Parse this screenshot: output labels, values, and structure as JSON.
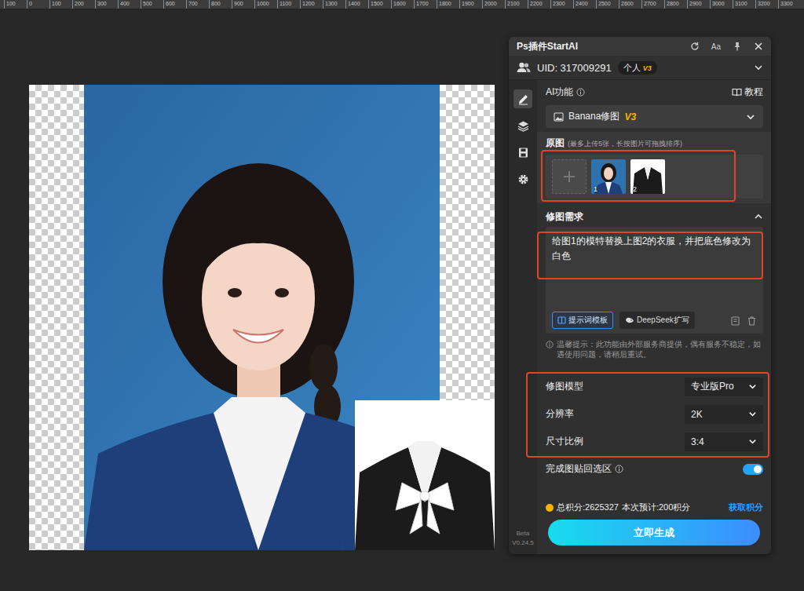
{
  "ruler": [
    "100",
    "0",
    "100",
    "200",
    "300",
    "400",
    "500",
    "600",
    "700",
    "800",
    "900",
    "1000",
    "1100",
    "1200",
    "1300",
    "1400",
    "1500",
    "1600",
    "1700",
    "1800",
    "1900",
    "2000",
    "2100",
    "2200",
    "2300",
    "2400",
    "2500",
    "2600",
    "2700",
    "2800",
    "2900",
    "3000",
    "3100",
    "3200",
    "3300"
  ],
  "panel": {
    "title": "Ps插件StartAI",
    "font_button": "Aa",
    "user": {
      "uid": "UID: 317009291",
      "plan": "个人",
      "plan_version": "V3"
    },
    "sidebar": {
      "items": [
        {
          "selected": true
        },
        {
          "selected": false
        },
        {
          "selected": false
        },
        {
          "selected": false
        }
      ],
      "beta": "Beta",
      "version": "V0.24.5"
    },
    "ai_function": {
      "label": "AI功能",
      "tutorial": "教程",
      "value": "Banana修图",
      "version": "V3"
    },
    "source_images": {
      "label": "原图",
      "hint": "(最多上传5张，长按图片可拖拽排序)",
      "highlighted": true,
      "items": [
        {
          "number": "1",
          "kind": "portrait"
        },
        {
          "number": "2",
          "kind": "garment"
        }
      ]
    },
    "prompt": {
      "label": "修图需求",
      "expanded": true,
      "highlighted": true,
      "text": "给图1的模特替换上图2的衣服，并把底色修改为白色",
      "buttons": [
        {
          "label": "提示词模板",
          "selected": true
        },
        {
          "label": "DeepSeek扩写",
          "selected": false
        }
      ]
    },
    "notice": "温馨提示：此功能由外部服务商提供，偶有服务不稳定，如遇使用问题，请稍后重试。",
    "settings": {
      "highlighted": true,
      "rows": [
        {
          "label": "修图模型",
          "value": "专业版Pro"
        },
        {
          "label": "分辨率",
          "value": "2K"
        },
        {
          "label": "尺寸比例",
          "value": "3:4"
        }
      ]
    },
    "paste_back": {
      "label": "完成图贴回选区",
      "on": true
    },
    "points": {
      "total": "总积分:2625327",
      "estimate": "本次预计:200积分",
      "link": "获取积分"
    },
    "generate": "立即生成"
  }
}
